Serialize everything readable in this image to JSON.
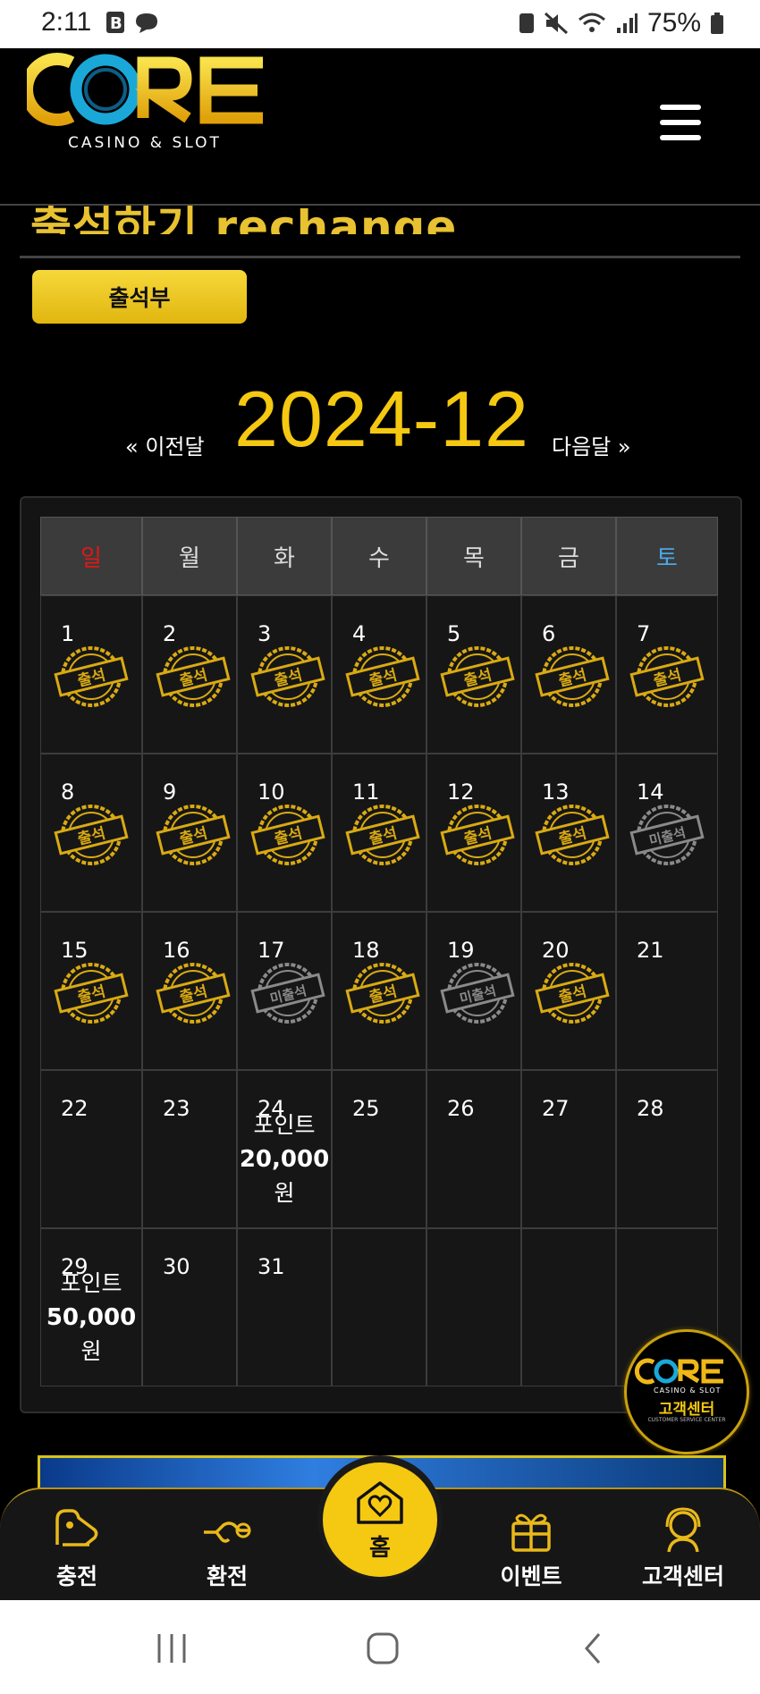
{
  "status_bar": {
    "time": "2:11",
    "battery": "75%"
  },
  "header": {
    "logo_main": "CORE",
    "logo_sub": "CASINO & SLOT"
  },
  "page": {
    "title": "출석하기 rechange",
    "attendance_button": "출석부"
  },
  "calendar": {
    "prev_label": "« 이전달",
    "next_label": "다음달 »",
    "month": "2024-12",
    "weekdays": [
      "일",
      "월",
      "화",
      "수",
      "목",
      "금",
      "토"
    ],
    "weeks": [
      [
        {
          "day": "1",
          "stamp": "출석"
        },
        {
          "day": "2",
          "stamp": "출석"
        },
        {
          "day": "3",
          "stamp": "출석"
        },
        {
          "day": "4",
          "stamp": "출석"
        },
        {
          "day": "5",
          "stamp": "출석"
        },
        {
          "day": "6",
          "stamp": "출석"
        },
        {
          "day": "7",
          "stamp": "출석"
        }
      ],
      [
        {
          "day": "8",
          "stamp": "출석"
        },
        {
          "day": "9",
          "stamp": "출석"
        },
        {
          "day": "10",
          "stamp": "출석"
        },
        {
          "day": "11",
          "stamp": "출석"
        },
        {
          "day": "12",
          "stamp": "출석"
        },
        {
          "day": "13",
          "stamp": "출석"
        },
        {
          "day": "14",
          "stamp": "미출석"
        }
      ],
      [
        {
          "day": "15",
          "stamp": "출석"
        },
        {
          "day": "16",
          "stamp": "출석"
        },
        {
          "day": "17",
          "stamp": "미출석"
        },
        {
          "day": "18",
          "stamp": "출석"
        },
        {
          "day": "19",
          "stamp": "미출석"
        },
        {
          "day": "20",
          "stamp": "출석"
        },
        {
          "day": "21"
        }
      ],
      [
        {
          "day": "22"
        },
        {
          "day": "23"
        },
        {
          "day": "24",
          "reward_label": "포인트",
          "reward_amount": "20,000",
          "reward_unit": "원"
        },
        {
          "day": "25"
        },
        {
          "day": "26"
        },
        {
          "day": "27"
        },
        {
          "day": "28"
        }
      ],
      [
        {
          "day": "29",
          "reward_label": "포인트",
          "reward_amount": "50,000",
          "reward_unit": "원"
        },
        {
          "day": "30"
        },
        {
          "day": "31"
        },
        {
          "day": ""
        },
        {
          "day": ""
        },
        {
          "day": ""
        },
        {
          "day": ""
        }
      ]
    ]
  },
  "customer_center_float": {
    "logo": "CORE",
    "logo_sub": "CASINO & SLOT",
    "label": "고객센터",
    "sub": "CUSTOMER SERVICE CENTER"
  },
  "bottom_nav": {
    "charge": "충전",
    "exchange": "환전",
    "home": "홈",
    "event": "이벤트",
    "support": "고객센터"
  },
  "colors": {
    "accent": "#f5c811",
    "sunday": "#e01818",
    "saturday": "#4aa8e8",
    "background": "#000000"
  }
}
